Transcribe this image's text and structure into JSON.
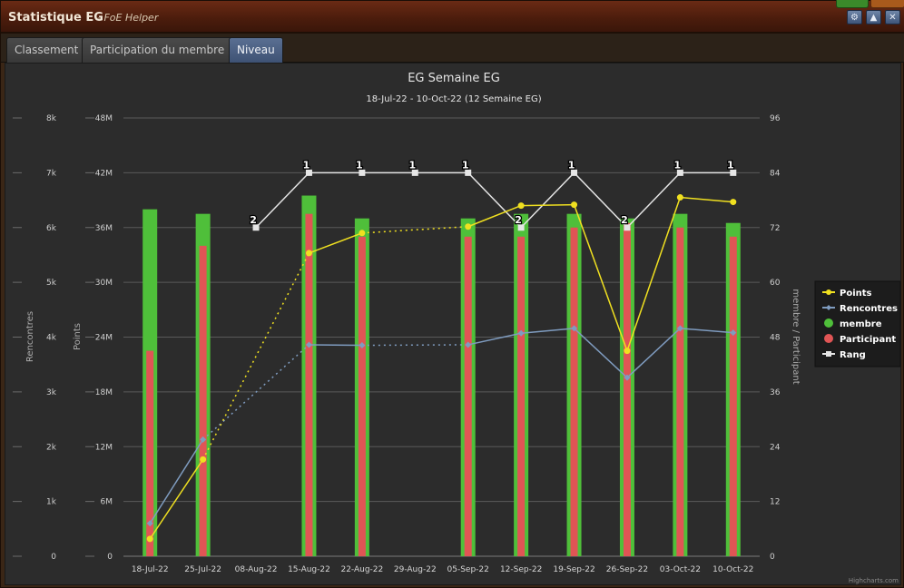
{
  "window": {
    "title": "Statistique EG",
    "subtitle": "- FoE Helper",
    "buttons": [
      {
        "name": "settings-button",
        "icon": "gear-icon",
        "glyph": "⚙"
      },
      {
        "name": "minimize-button",
        "icon": "chevron-up-icon",
        "glyph": "▲"
      },
      {
        "name": "close-button",
        "icon": "close-icon",
        "glyph": "✕"
      }
    ]
  },
  "tabs": [
    {
      "label": "Classement",
      "active": false
    },
    {
      "label": "Participation du membre",
      "active": false
    },
    {
      "label": "Niveau",
      "active": true
    }
  ],
  "chart_data": {
    "type": "bar",
    "title": "EG Semaine EG",
    "subtitle": "18-Jul-22 - 10-Oct-22 (12 Semaine EG)",
    "categories": [
      "18-Jul-22",
      "25-Jul-22",
      "08-Aug-22",
      "15-Aug-22",
      "22-Aug-22",
      "29-Aug-22",
      "05-Sep-22",
      "12-Sep-22",
      "19-Sep-22",
      "26-Sep-22",
      "03-Oct-22",
      "10-Oct-22"
    ],
    "axes": {
      "rencontres": {
        "label": "Rencontres",
        "min": 0,
        "max": 8000,
        "ticks": [
          "0",
          "1k",
          "2k",
          "3k",
          "4k",
          "5k",
          "6k",
          "7k",
          "8k"
        ]
      },
      "points": {
        "label": "Points",
        "min": 0,
        "max": 48000000,
        "ticks": [
          "0",
          "6M",
          "12M",
          "18M",
          "24M",
          "30M",
          "36M",
          "42M",
          "48M"
        ]
      },
      "membre": {
        "label": "membre / Participant",
        "min": 0,
        "max": 96,
        "ticks": [
          "0",
          "12",
          "24",
          "36",
          "48",
          "60",
          "72",
          "84",
          "96"
        ]
      }
    },
    "series": [
      {
        "name": "membre",
        "type": "bar",
        "axis": "membre",
        "color": "#4fbf3a",
        "values": [
          76,
          75,
          null,
          79,
          74,
          null,
          74,
          75,
          75,
          74,
          75,
          73
        ]
      },
      {
        "name": "Participant",
        "type": "bar",
        "axis": "membre",
        "color": "#e05555",
        "values": [
          45,
          68,
          null,
          75,
          70,
          null,
          70,
          70,
          72,
          73,
          72,
          70
        ]
      },
      {
        "name": "Points",
        "type": "line",
        "axis": "points",
        "color": "#f0e020",
        "values": [
          1900000,
          10600000,
          null,
          33200000,
          35400000,
          null,
          36100000,
          38400000,
          38500000,
          22500000,
          39300000,
          38800000
        ]
      },
      {
        "name": "Rencontres",
        "type": "line",
        "axis": "rencontres",
        "color": "#7f9cc0",
        "values": [
          600,
          2130,
          null,
          3860,
          3850,
          null,
          3860,
          4070,
          4160,
          3260,
          4160,
          4080
        ]
      },
      {
        "name": "Rang",
        "type": "line",
        "axis": "membre",
        "color": "#e6e6e6",
        "values": [
          null,
          null,
          72,
          84,
          84,
          84,
          84,
          72,
          84,
          72,
          84,
          84
        ],
        "labels": [
          null,
          null,
          "2",
          "1",
          "1",
          "1",
          "1",
          "2",
          "1",
          "2",
          "1",
          "1"
        ]
      }
    ],
    "legend": {
      "position": "right",
      "items": [
        "Points",
        "Rencontres",
        "membre",
        "Participant",
        "Rang"
      ]
    },
    "credit": "Highcharts.com"
  }
}
